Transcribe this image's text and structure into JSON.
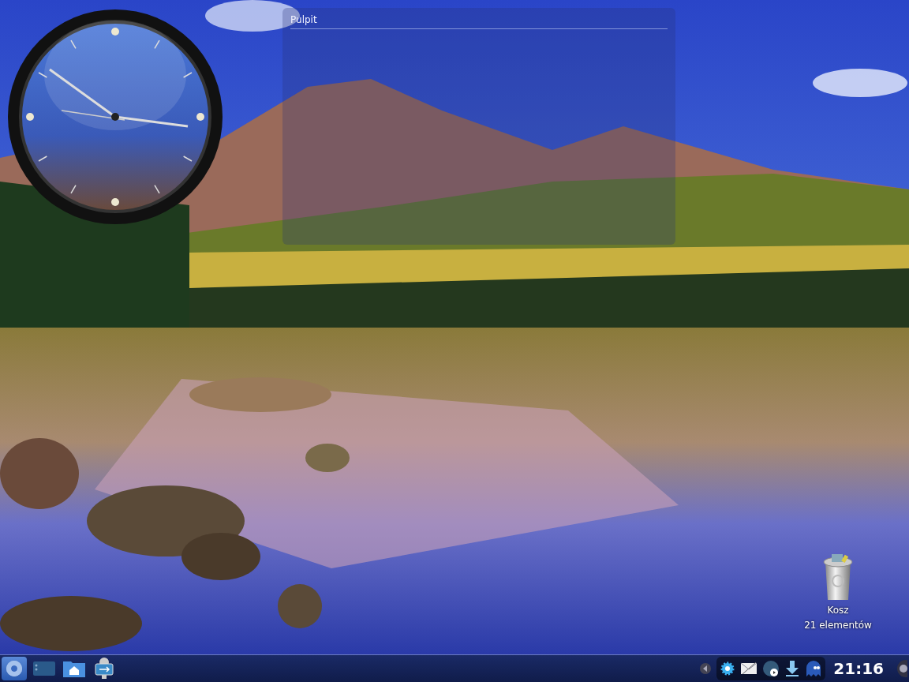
{
  "desktop": {
    "folder_view": {
      "title": "Pulpit"
    },
    "icons": [
      {
        "label": "Kosz",
        "subtitle": "21 elementów"
      }
    ]
  },
  "panel": {
    "clock": "21:16"
  }
}
